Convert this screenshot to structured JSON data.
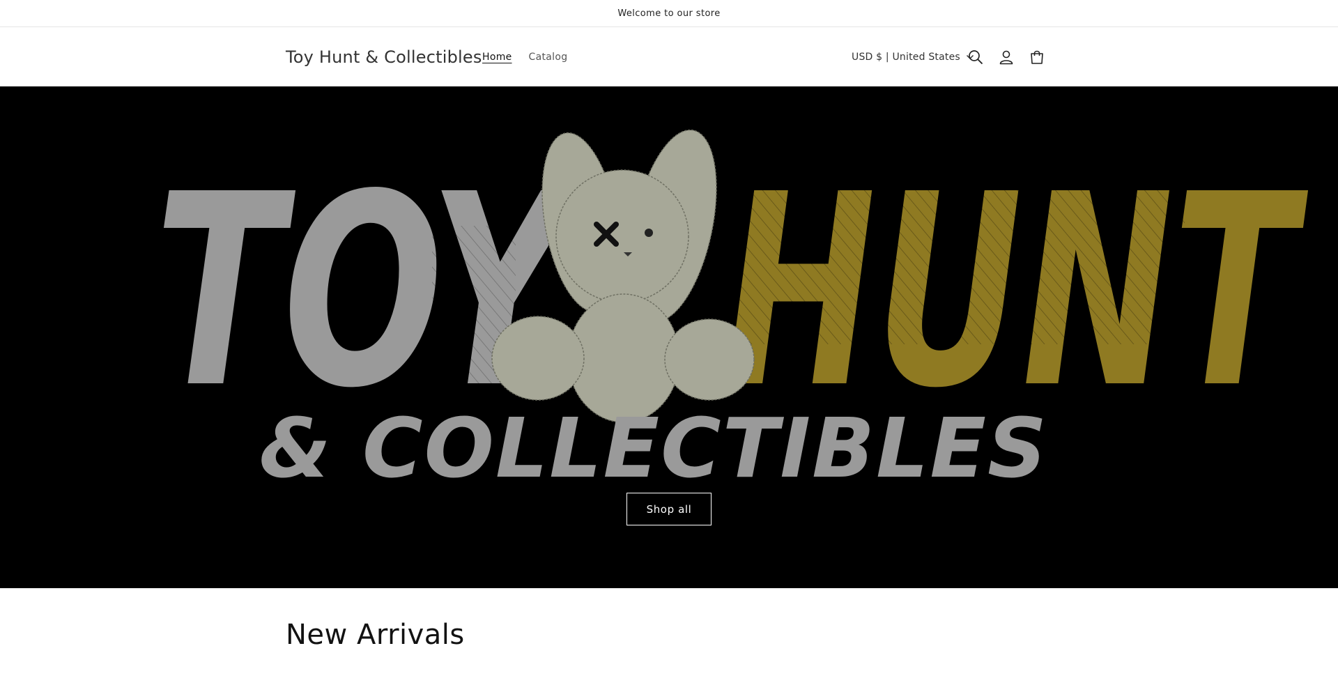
{
  "announcement": {
    "text": "Welcome to our store"
  },
  "header": {
    "store_name": "Toy Hunt & Collectibles",
    "nav": [
      {
        "label": "Home",
        "active": true
      },
      {
        "label": "Catalog",
        "active": false
      }
    ],
    "localization": {
      "label": "USD $ | United States"
    },
    "icons": [
      "search-icon",
      "account-icon",
      "cart-icon"
    ]
  },
  "hero": {
    "logo_text": {
      "word1": "TOY",
      "word2": "HUNT",
      "line2": "& COLLECTIBLES"
    },
    "colors": {
      "background": "#000000",
      "toy": "#9a9a9a",
      "hunt": "#8f7a22",
      "bunny": "#a7a898"
    },
    "button_label": "Shop all"
  },
  "section": {
    "title": "New Arrivals"
  }
}
